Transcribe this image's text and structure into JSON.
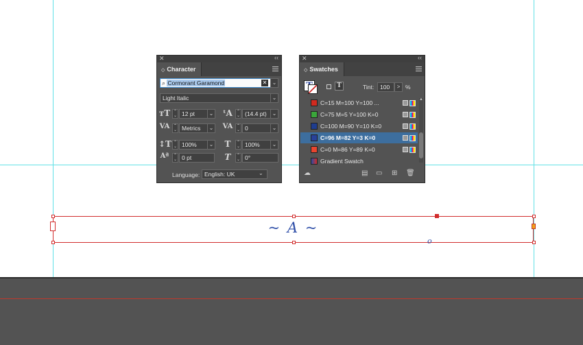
{
  "canvas": {
    "frame_text": "~ A ~",
    "frame_port_label": "o"
  },
  "character_panel": {
    "title": "Character",
    "font_family": "Cormorant Garamond",
    "font_style": "Light Italic",
    "font_size": "12 pt",
    "leading": "(14.4 pt)",
    "kerning": "Metrics",
    "tracking": "0",
    "vertical_scale": "100%",
    "horizontal_scale": "100%",
    "baseline_shift": "0 pt",
    "skew": "0°",
    "language_label": "Language:",
    "language_value": "English: UK"
  },
  "swatches_panel": {
    "title": "Swatches",
    "tint_label": "Tint:",
    "tint_value": "100",
    "tint_arrow": ">",
    "tint_unit": "%",
    "items": [
      {
        "name": "C=15 M=100 Y=100 ...",
        "color": "#d12a1f",
        "selected": false
      },
      {
        "name": "C=75 M=5 Y=100 K=0",
        "color": "#3aa63a",
        "selected": false
      },
      {
        "name": "C=100 M=90 Y=10 K=0",
        "color": "#1f3d8f",
        "selected": false
      },
      {
        "name": "C=96 M=82 Y=3 K=0",
        "color": "#28429a",
        "selected": true
      },
      {
        "name": "C=0 M=86 Y=89 K=0",
        "color": "#e8452e",
        "selected": false
      },
      {
        "name": "Gradient Swatch",
        "color": "#2b4ca0",
        "selected": false
      }
    ]
  },
  "colors": {
    "guide": "#5fe0e6",
    "frame": "#d12c2c",
    "text": "#2f4fa8",
    "panel_bg": "#535353",
    "selected_row": "#3d6e9e"
  }
}
